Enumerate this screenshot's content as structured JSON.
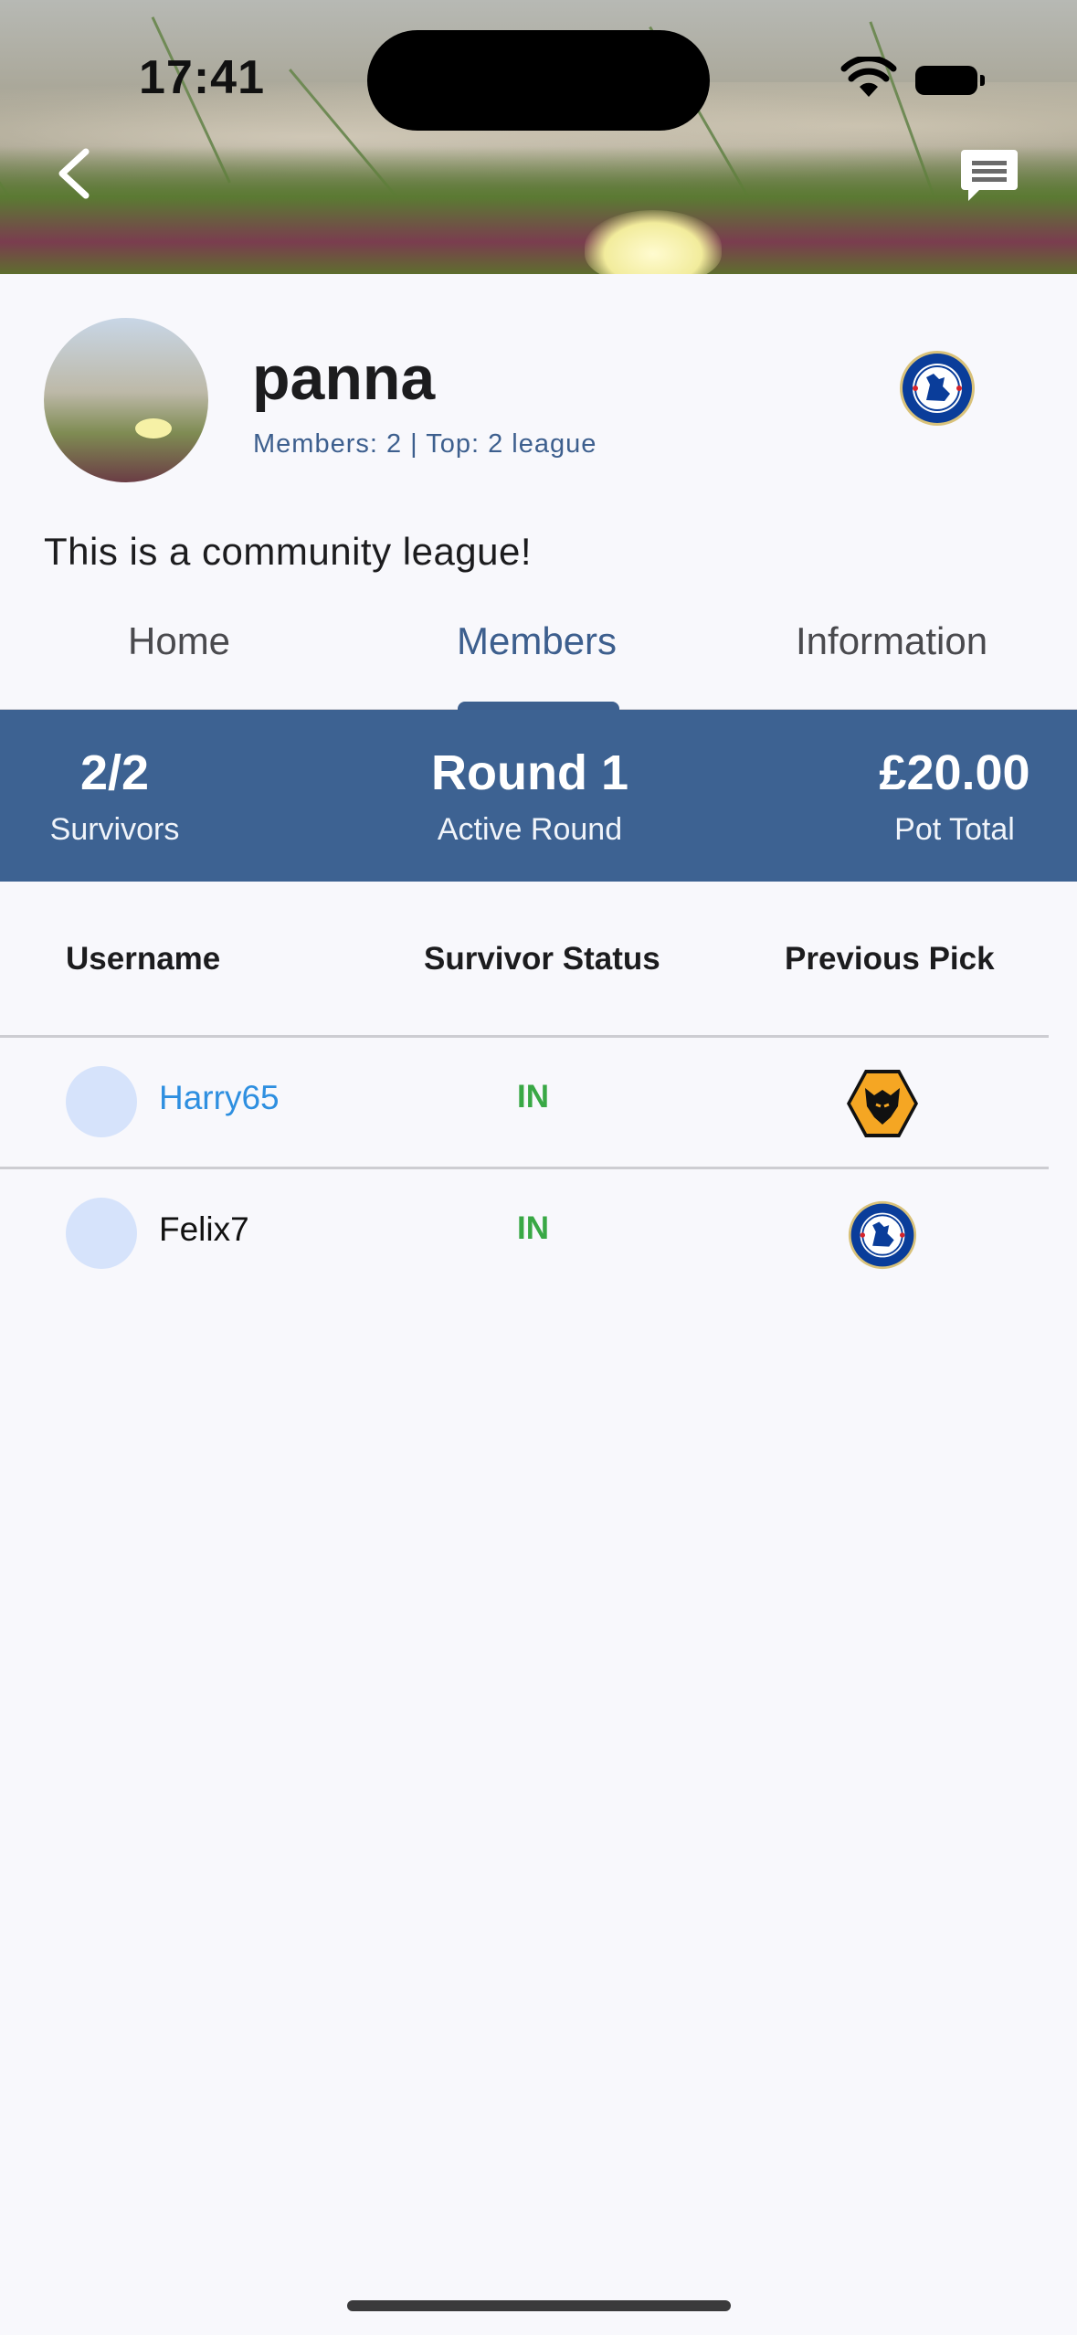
{
  "status_bar": {
    "time": "17:41"
  },
  "header": {
    "back_icon": "chevron-left-icon",
    "chat_icon": "chat-bubble-icon"
  },
  "league": {
    "name": "panna",
    "meta": "Members: 2 | Top: 2 league",
    "description": "This is a community league!",
    "team_badge": "chelsea-crest-icon"
  },
  "tabs": [
    {
      "label": "Home"
    },
    {
      "label": "Members"
    },
    {
      "label": "Information"
    }
  ],
  "active_tab": "Members",
  "stats": {
    "survivors_value": "2/2",
    "survivors_label": "Survivors",
    "round_value": "Round 1",
    "round_label": "Active Round",
    "pot_value": "£20.00",
    "pot_label": "Pot Total"
  },
  "table": {
    "headers": [
      "Username",
      "Survivor Status",
      "Previous Pick"
    ],
    "rows": [
      {
        "username": "Harry65",
        "status": "IN",
        "pick": "wolves-crest-icon",
        "highlight_color": "#2e8fe0"
      },
      {
        "username": "Felix7",
        "status": "IN",
        "pick": "chelsea-crest-icon",
        "highlight_color": "#111111"
      }
    ]
  },
  "colors": {
    "accent": "#3d6292",
    "status_in": "#39a845",
    "link": "#2e8fe0"
  }
}
